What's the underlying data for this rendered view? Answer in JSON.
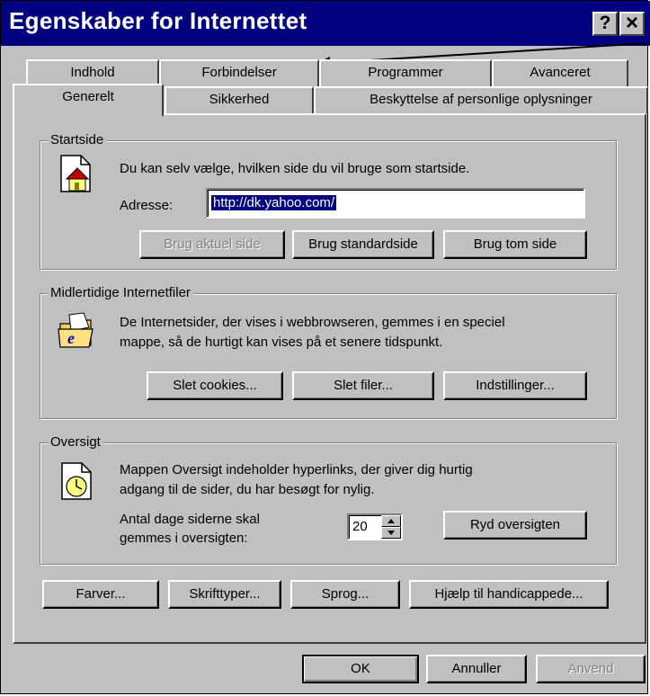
{
  "window": {
    "title": "Egenskaber for Internettet",
    "help_button": "?",
    "close_button": "×"
  },
  "tabs_back": [
    {
      "label": "Indhold"
    },
    {
      "label": "Forbindelser"
    },
    {
      "label": "Programmer"
    },
    {
      "label": "Avanceret"
    }
  ],
  "tabs_front": [
    {
      "label": "Generelt"
    },
    {
      "label": "Sikkerhed"
    },
    {
      "label": "Beskyttelse af personlige oplysninger"
    }
  ],
  "homepage": {
    "group_label": "Startside",
    "description": "Du kan selv vælge, hvilken side du vil bruge som startside.",
    "address_label": "Adresse:",
    "address_value": "http://dk.yahoo.com/",
    "use_current_label": "Brug aktuel side",
    "use_default_label": "Brug standardside",
    "use_blank_label": "Brug tom side"
  },
  "temp_files": {
    "group_label": "Midlertidige Internetfiler",
    "description_line1": "De Internetsider, der vises i webbrowseren, gemmes i en speciel",
    "description_line2": "mappe, så de hurtigt kan vises på et senere tidspunkt.",
    "delete_cookies_label": "Slet cookies...",
    "delete_files_label": "Slet filer...",
    "settings_label": "Indstillinger..."
  },
  "history": {
    "group_label": "Oversigt",
    "description_line1": "Mappen Oversigt indeholder hyperlinks, der giver dig hurtig",
    "description_line2": "adgang til de sider, du har besøgt for nylig.",
    "days_label_line1": "Antal dage siderne skal",
    "days_label_line2": "gemmes i oversigten:",
    "days_value": "20",
    "clear_label": "Ryd oversigten"
  },
  "bottom_buttons": {
    "colors_label": "Farver...",
    "fonts_label": "Skrifttyper...",
    "languages_label": "Sprog...",
    "accessibility_label": "Hjælp til handicappede..."
  },
  "dialog_buttons": {
    "ok_label": "OK",
    "cancel_label": "Annuller",
    "apply_label": "Anvend"
  }
}
